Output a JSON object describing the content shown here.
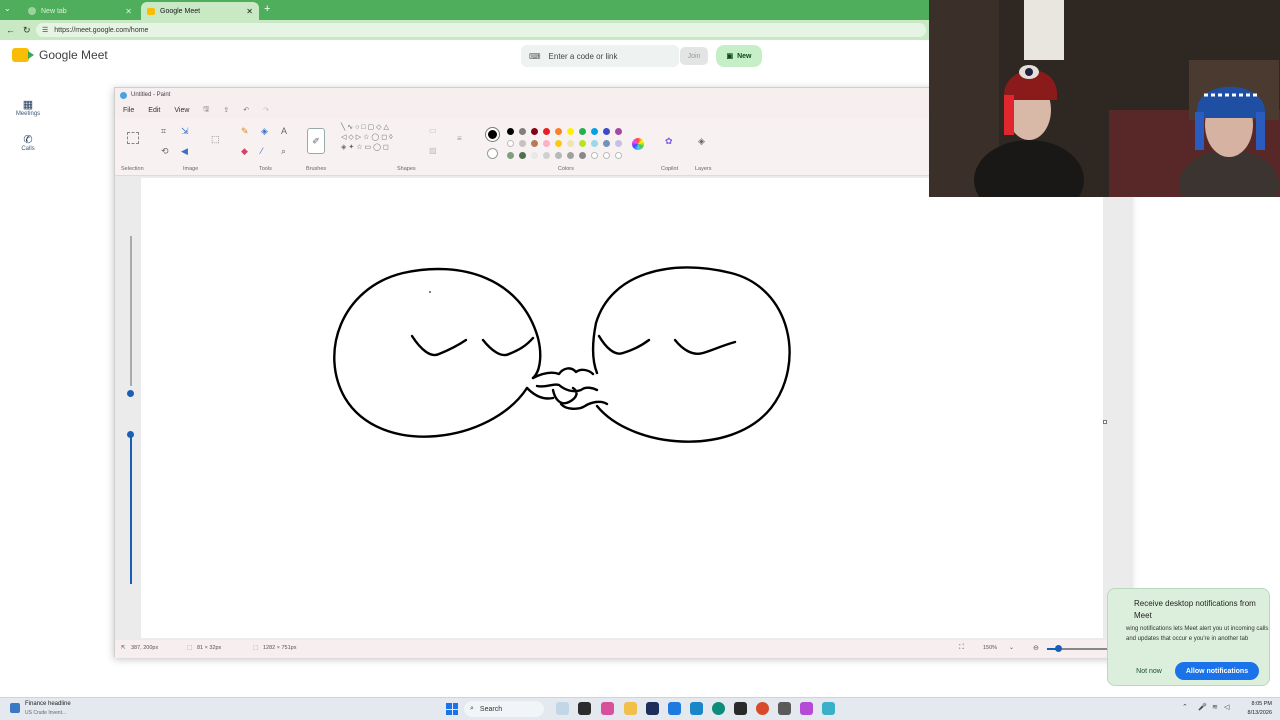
{
  "browser": {
    "tabs": [
      {
        "title": "New tab",
        "active": false
      },
      {
        "title": "Google Meet",
        "active": true
      }
    ],
    "new_tab_symbol": "+",
    "url": "https://meet.google.com/home"
  },
  "meet": {
    "logo_text": "Google Meet",
    "code_placeholder": "Enter a code or link",
    "join_label": "Join",
    "new_label": "New",
    "nav": [
      {
        "label": "Meetings",
        "icon": "calendar-icon"
      },
      {
        "label": "Calls",
        "icon": "phone-icon"
      }
    ]
  },
  "paint": {
    "title": "Untitled - Paint",
    "menu": [
      "File",
      "Edit",
      "View"
    ],
    "groups": [
      "Selection",
      "Image",
      "Tools",
      "Brushes",
      "Shapes",
      "Colors",
      "Copilot",
      "Layers"
    ],
    "palette_row1": [
      "#000000",
      "#7f7f7f",
      "#880015",
      "#ed1c24",
      "#ff7f27",
      "#fff200",
      "#22b14c",
      "#00a2e8",
      "#3f48cc",
      "#a349a4"
    ],
    "palette_row2": [
      "#ffffff",
      "#c3c3c3",
      "#b97a57",
      "#ffaec9",
      "#ffc90e",
      "#efe4b0",
      "#b5e61d",
      "#99d9ea",
      "#7092be",
      "#c8bfe7"
    ],
    "palette_row3": [
      "#7f9f7f",
      "#4f6f4f",
      "#e8e8e8",
      "#d0d0d0",
      "#b8b8b8",
      "#a0a0a0",
      "#888888",
      "#ffffff",
      "#ffffff",
      "#ffffff"
    ],
    "status": {
      "cursor": "387, 200px",
      "selection": "81 × 32px",
      "canvas_size": "1282 × 751px",
      "zoom": "150%"
    }
  },
  "notification": {
    "title": "Receive desktop notifications from Meet",
    "body": "wing notifications lets Meet alert you ut incoming calls and updates that occur e you're in another tab",
    "not_now": "Not now",
    "allow": "Allow notifications"
  },
  "taskbar": {
    "widget_title": "Finance headline",
    "widget_sub": "US Crude Invent...",
    "search": "Search",
    "time": "8:05 PM",
    "date": "8/13/2026"
  },
  "colors": {
    "browser_green": "#4fae5b",
    "meet_new_btn": "#c6efc8",
    "allow_btn": "#1a73e8"
  }
}
